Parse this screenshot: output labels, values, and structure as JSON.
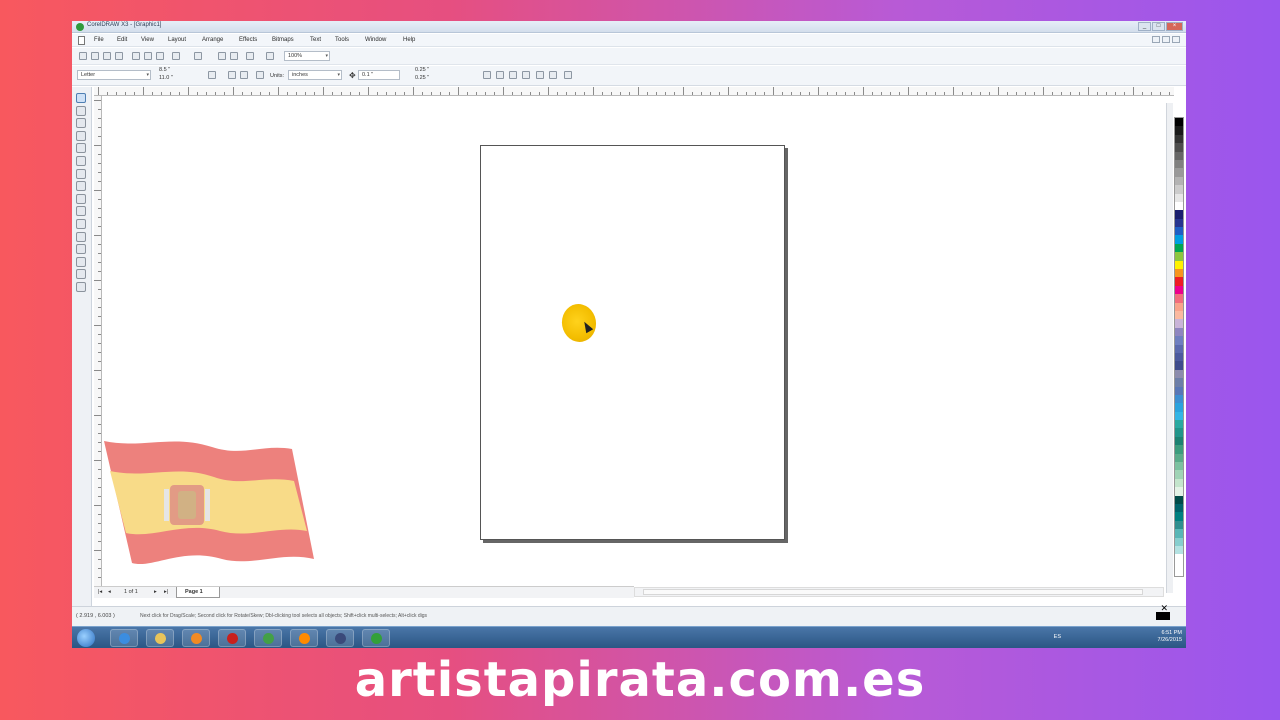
{
  "window": {
    "title": "CorelDRAW X3 - [Graphic1]"
  },
  "menu": [
    "File",
    "Edit",
    "View",
    "Layout",
    "Arrange",
    "Effects",
    "Bitmaps",
    "Text",
    "Tools",
    "Window",
    "Help"
  ],
  "toolbar": {
    "zoom": "100%",
    "paper_size": "Letter",
    "width": "8.5 \"",
    "height": "11.0 \"",
    "units_label": "Units:",
    "units": "inches",
    "nudge": "0.1 \"",
    "dup_x": "0.25 \"",
    "dup_y": "0.25 \""
  },
  "page_nav": {
    "count": "1 of 1",
    "tab": "Page 1"
  },
  "status": {
    "coords": "( 2.919 , 6.003 )",
    "message": "Next click for Drag/Scale; Second click for Rotate/Skew; Dbl-clicking tool selects all objects; Shift+click multi-selects; Alt+click digs"
  },
  "taskbar": {
    "lang": "ES",
    "time": "6:51 PM",
    "date": "7/26/2015",
    "apps": [
      {
        "name": "internet-explorer",
        "color": "#3b8de0"
      },
      {
        "name": "file-explorer",
        "color": "#e8c45a"
      },
      {
        "name": "media-player",
        "color": "#f08a24"
      },
      {
        "name": "record-app",
        "color": "#c8201d"
      },
      {
        "name": "chrome",
        "color": "#43a047"
      },
      {
        "name": "vlc",
        "color": "#ff8a00"
      },
      {
        "name": "app-orb",
        "color": "#3a4a7a"
      },
      {
        "name": "coreldraw",
        "color": "#33a03a"
      }
    ]
  },
  "palette": [
    "#000000",
    "#1a1a1a",
    "#333333",
    "#4d4d4d",
    "#666666",
    "#808080",
    "#999999",
    "#b3b3b3",
    "#cccccc",
    "#e6e6e6",
    "#ffffff",
    "#1b1f6e",
    "#27358f",
    "#1f5fc4",
    "#009ee0",
    "#00a651",
    "#8dc63f",
    "#fff200",
    "#f7941d",
    "#ed1c24",
    "#ec008c",
    "#f26d7d",
    "#f9a38b",
    "#fbb9a0",
    "#c9b4d8",
    "#8f86c0",
    "#6f7fc0",
    "#5b6aae",
    "#4c5a9e",
    "#3f4c8c",
    "#8c8cad",
    "#6d7fa8",
    "#5977b6",
    "#3d8fd1",
    "#2ba3dd",
    "#33b5e5",
    "#2aa9a0",
    "#22958a",
    "#1d8272",
    "#3c9c7d",
    "#5aab8a",
    "#7cc1a0",
    "#9fd3b5",
    "#c3e5cc",
    "#e3f2e6",
    "#004b49",
    "#00636b",
    "#008080",
    "#2f8f8f",
    "#58b6b6",
    "#86cece",
    "#b3e2e2"
  ],
  "watermark": "artistapirata.com.es"
}
